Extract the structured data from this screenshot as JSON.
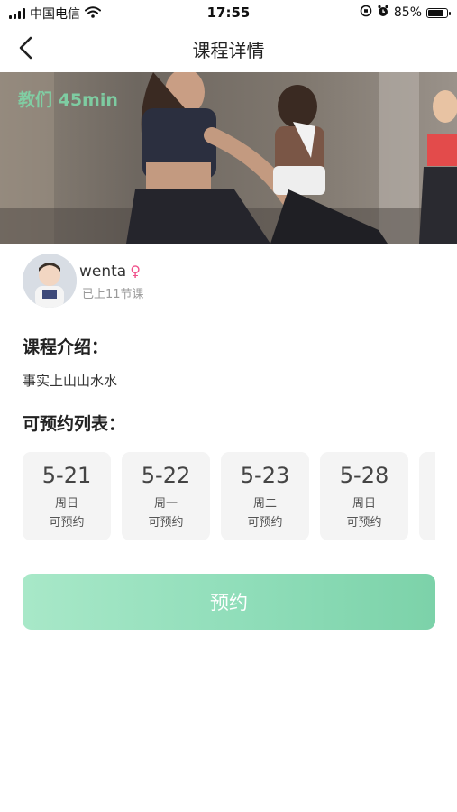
{
  "status_bar": {
    "carrier": "中国电信",
    "time": "17:55",
    "battery_text": "85%",
    "battery_level": 0.85,
    "icons": [
      "signal-icon",
      "wifi-icon",
      "rotation-lock-icon",
      "alarm-icon",
      "battery-icon"
    ]
  },
  "nav": {
    "title": "课程详情",
    "back_icon": "back-chevron-icon"
  },
  "banner": {
    "caption": "教们 45min"
  },
  "teacher": {
    "name": "wenta",
    "gender_icon": "female-icon",
    "gender_symbol": "♀",
    "lessons": "已上11节课"
  },
  "intro": {
    "heading": "课程介绍：",
    "text": "事实上山山水水"
  },
  "schedule": {
    "heading": "可预约列表：",
    "items": [
      {
        "date": "5-21",
        "weekday": "周日",
        "status": "可预约"
      },
      {
        "date": "5-22",
        "weekday": "周一",
        "status": "可预约"
      },
      {
        "date": "5-23",
        "weekday": "周二",
        "status": "可预约"
      },
      {
        "date": "5-28",
        "weekday": "周日",
        "status": "可预约"
      }
    ]
  },
  "action": {
    "book_label": "预约"
  },
  "colors": {
    "accent": "#8fddb9",
    "female": "#f0508a",
    "card_bg": "#f4f4f4"
  }
}
